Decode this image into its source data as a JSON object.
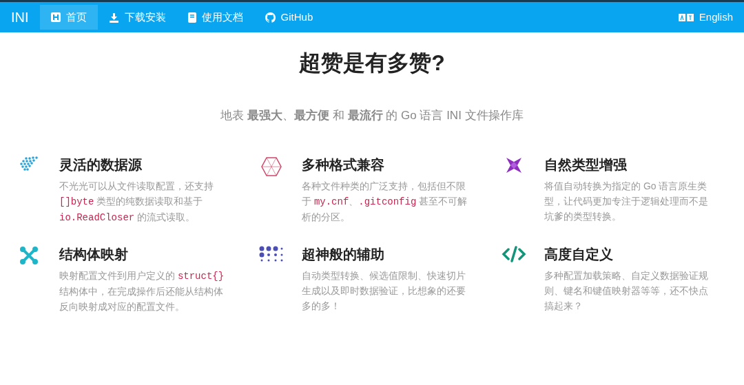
{
  "navbar": {
    "brand": "INI",
    "items": [
      {
        "label": "首页",
        "selected": true
      },
      {
        "label": "下载安装",
        "selected": false
      },
      {
        "label": "使用文档",
        "selected": false
      },
      {
        "label": "GitHub",
        "selected": false
      }
    ],
    "language": "English"
  },
  "title": "超赞是有多赞?",
  "subtitle": "地表 **最强大**、**最方便** 和 **最流行** 的 Go 语言 INI 文件操作库",
  "features": [
    {
      "title": "灵活的数据源",
      "description": [
        {
          "kind": "text",
          "text": "不光光可以从文件读取配置，还支持 "
        },
        {
          "kind": "code",
          "text": "[]byte"
        },
        {
          "kind": "text",
          "text": " 类型的纯数据读取和基于 "
        },
        {
          "kind": "code",
          "text": "io.ReadCloser"
        },
        {
          "kind": "text",
          "text": " 的流式读取。"
        }
      ]
    },
    {
      "title": "多种格式兼容",
      "description": [
        {
          "kind": "text",
          "text": "各种文件种类的广泛支持，包括但不限于 "
        },
        {
          "kind": "code",
          "text": "my.cnf"
        },
        {
          "kind": "text",
          "text": "、"
        },
        {
          "kind": "code",
          "text": ".gitconfig"
        },
        {
          "kind": "text",
          "text": " 甚至不可解析的分区。"
        }
      ]
    },
    {
      "title": "自然类型增强",
      "description": [
        {
          "kind": "text",
          "text": "将值自动转换为指定的 Go 语言原生类型，让代码更加专注于逻辑处理而不是坑爹的类型转换。"
        }
      ]
    },
    {
      "title": "结构体映射",
      "description": [
        {
          "kind": "text",
          "text": "映射配置文件到用户定义的 "
        },
        {
          "kind": "code",
          "text": "struct{}"
        },
        {
          "kind": "text",
          "text": " 结构体中，在完成操作后还能从结构体反向映射成对应的配置文件。"
        }
      ]
    },
    {
      "title": "超神般的辅助",
      "description": [
        {
          "kind": "text",
          "text": "自动类型转换、候选值限制、快速切片生成以及即时数据验证，比想象的还要多的多！"
        }
      ]
    },
    {
      "title": "高度自定义",
      "description": [
        {
          "kind": "text",
          "text": "多种配置加载策略、自定义数据验证规则、键名和键值映射器等等，还不快点搞起来？"
        }
      ]
    }
  ]
}
